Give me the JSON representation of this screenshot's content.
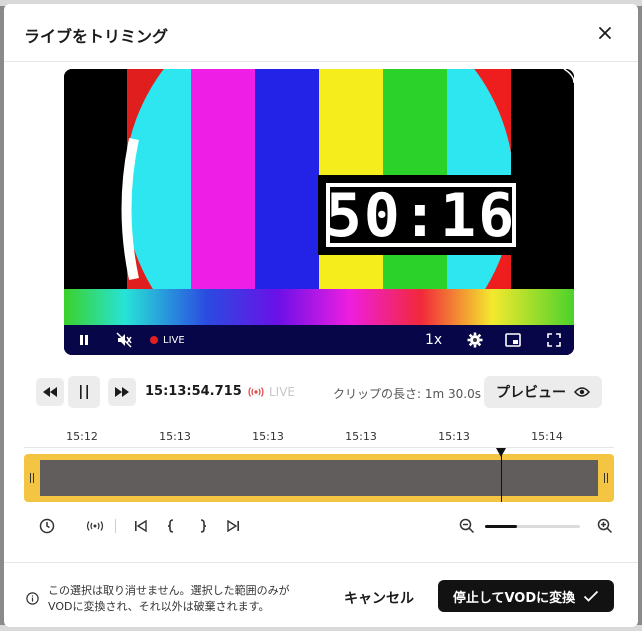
{
  "dialog": {
    "title": "ライブをトリミング"
  },
  "player": {
    "clock_text": "50:16",
    "live_label": "LIVE",
    "speed_label": "1x"
  },
  "transport": {
    "timecode": "15:13:54.715",
    "live_label": "LIVE",
    "clip_length": "クリップの長さ: 1m 30.0s",
    "preview_label": "プレビュー"
  },
  "timeline": {
    "ticks": [
      "15:12",
      "15:13",
      "15:13",
      "15:13",
      "15:13",
      "15:14"
    ],
    "playhead_fraction": 0.809,
    "zoom_level_fraction": 0.34
  },
  "footer": {
    "warning_line1": "この選択は取り消せません。選択した範囲のみが",
    "warning_line2": "VODに変換され、それ以外は破棄されます。",
    "cancel_label": "キャンセル",
    "convert_label": "停止してVODに変換"
  },
  "colors": {
    "accent_yellow": "#f4c543",
    "track": "#625d5d",
    "primary_button": "#121212"
  }
}
